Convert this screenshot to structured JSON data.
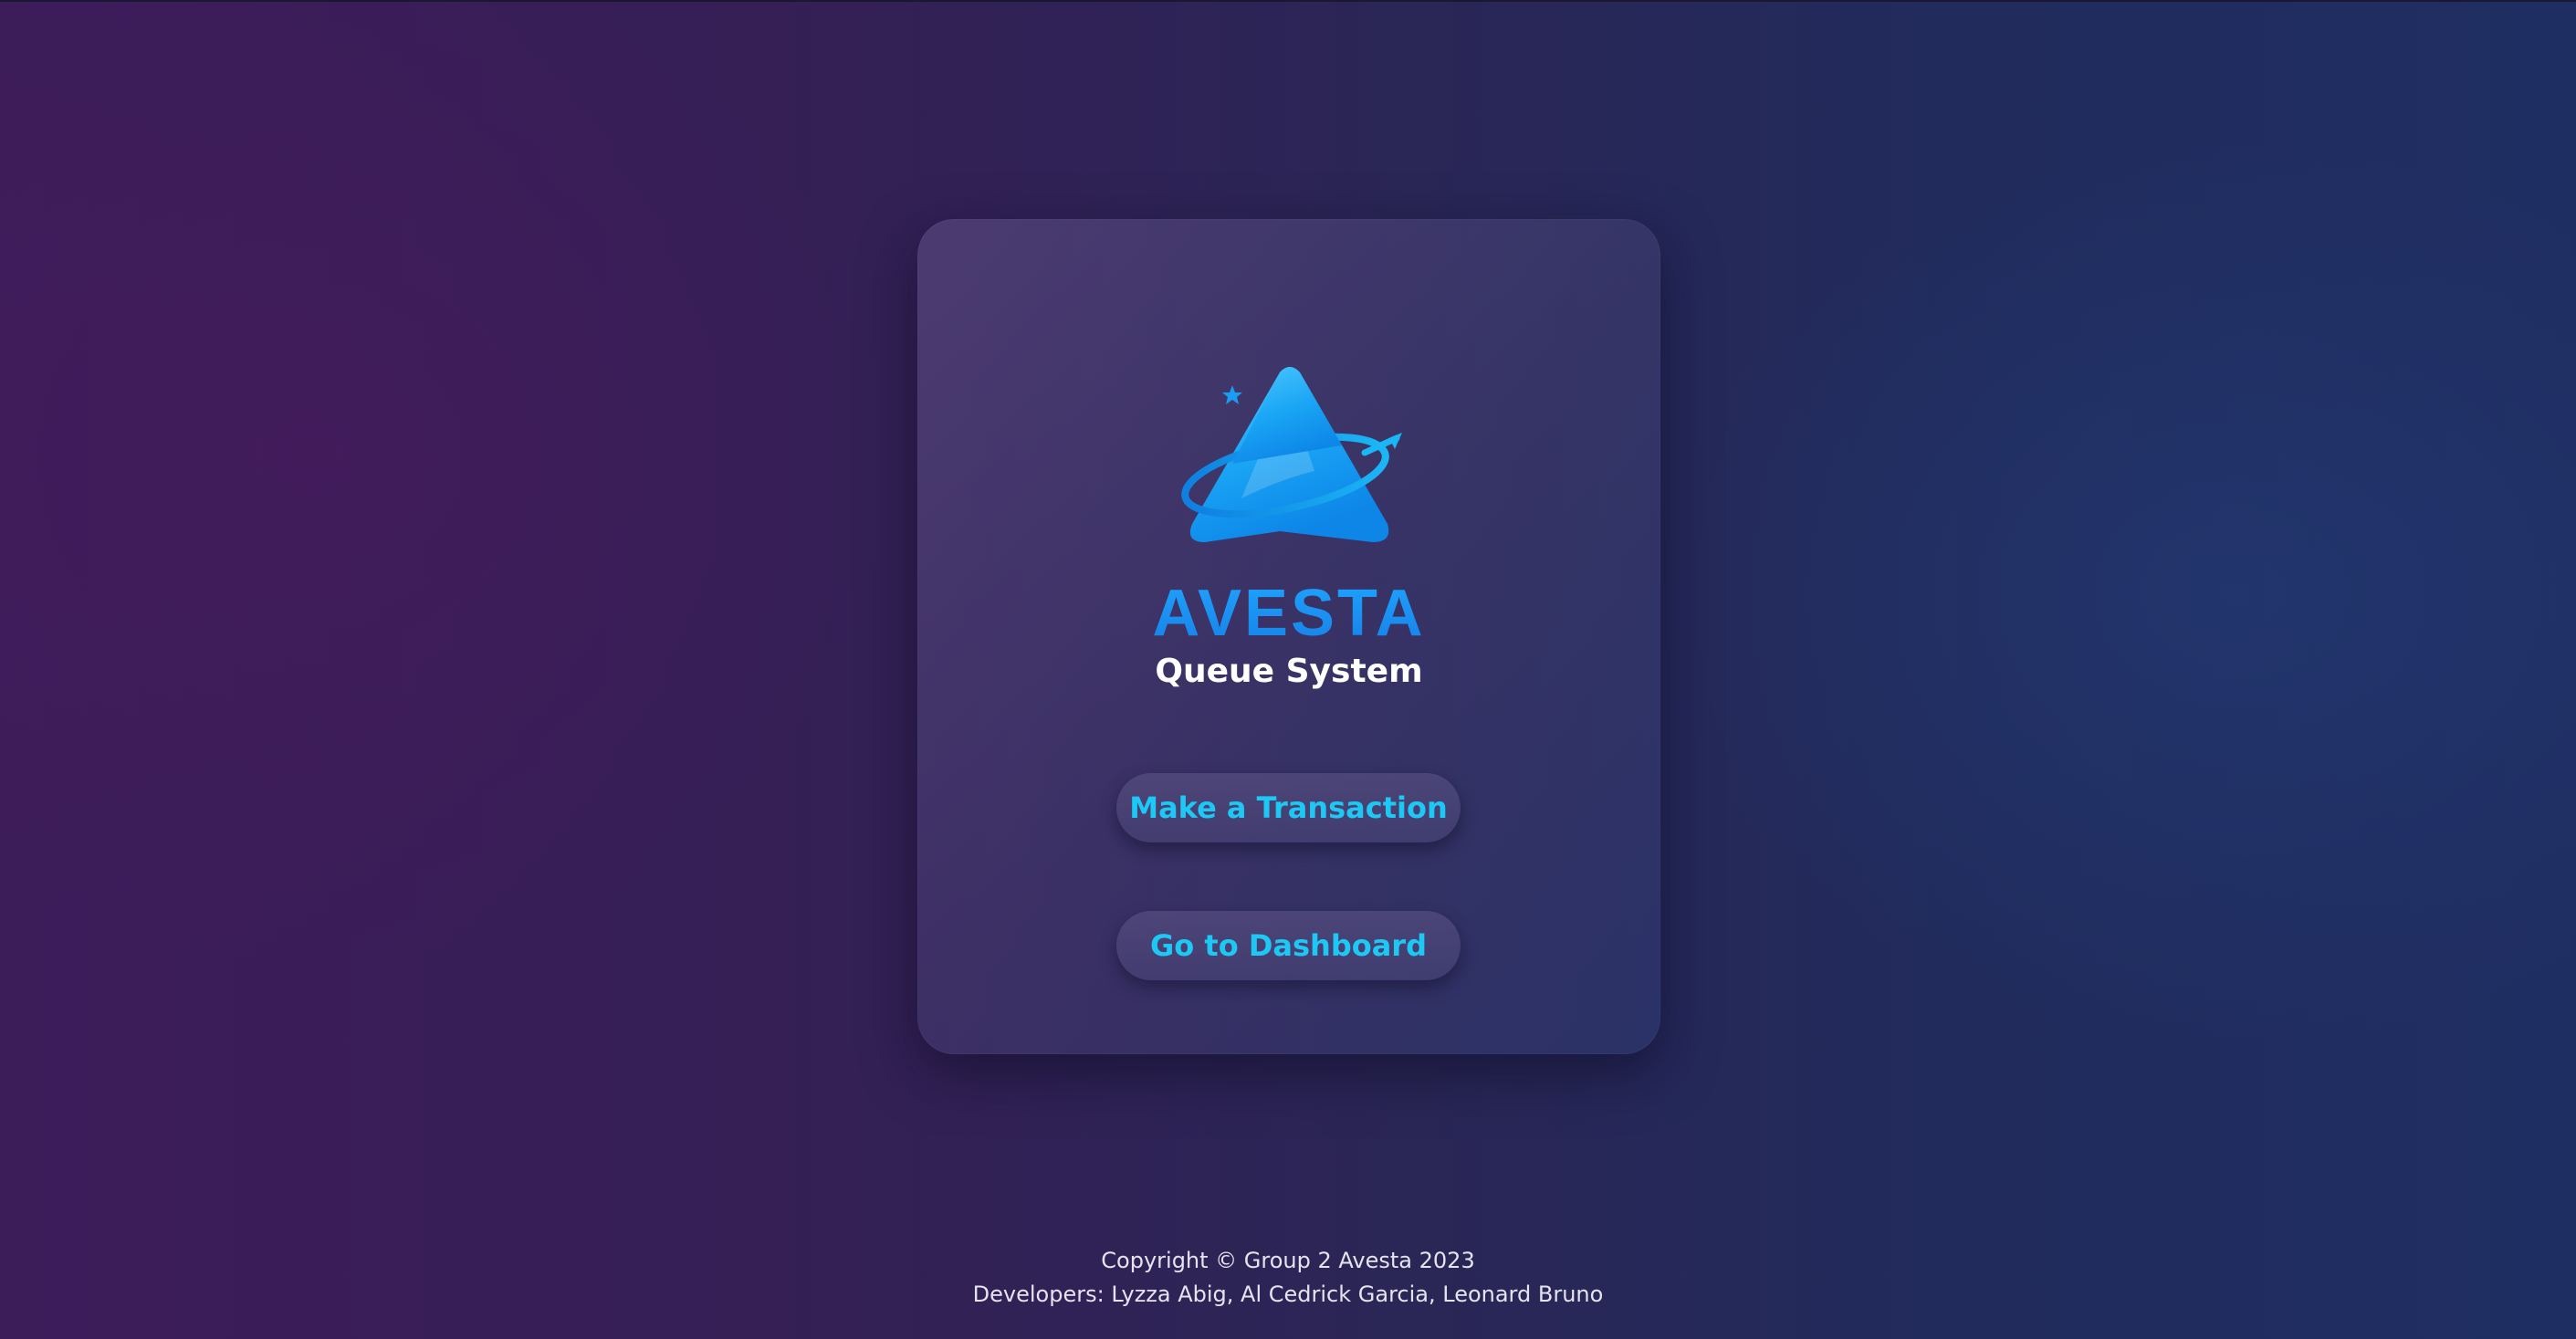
{
  "brand": {
    "name": "AVESTA",
    "subtitle": "Queue System",
    "logo_icon": "avesta-triangle-orbit-logo",
    "colors": {
      "brand_blue": "#1a8cf0",
      "button_text": "#1ec8f5"
    }
  },
  "actions": {
    "make_transaction_label": "Make a Transaction",
    "dashboard_label": "Go to Dashboard"
  },
  "footer": {
    "copyright": "Copyright © Group 2 Avesta 2023",
    "developers": "Developers: Lyzza Abig, Al Cedrick Garcia, Leonard Bruno"
  }
}
